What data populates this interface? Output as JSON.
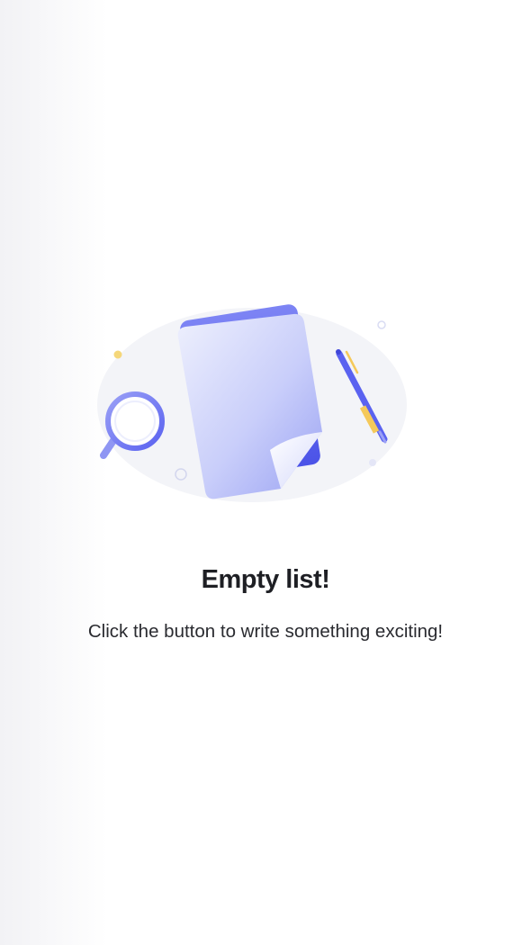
{
  "empty_state": {
    "title": "Empty list!",
    "message": "Click the button to write something exciting!",
    "illustration": {
      "icons": [
        "document-icon",
        "magnifier-icon",
        "pen-icon"
      ]
    }
  },
  "colors": {
    "accent": "#5a62f0",
    "accent_light": "#c7cdfb",
    "pen_yellow": "#f5c95a",
    "backdrop": "#f3f4f8",
    "title_text": "#1e1f24",
    "body_text": "#2a2b30"
  }
}
